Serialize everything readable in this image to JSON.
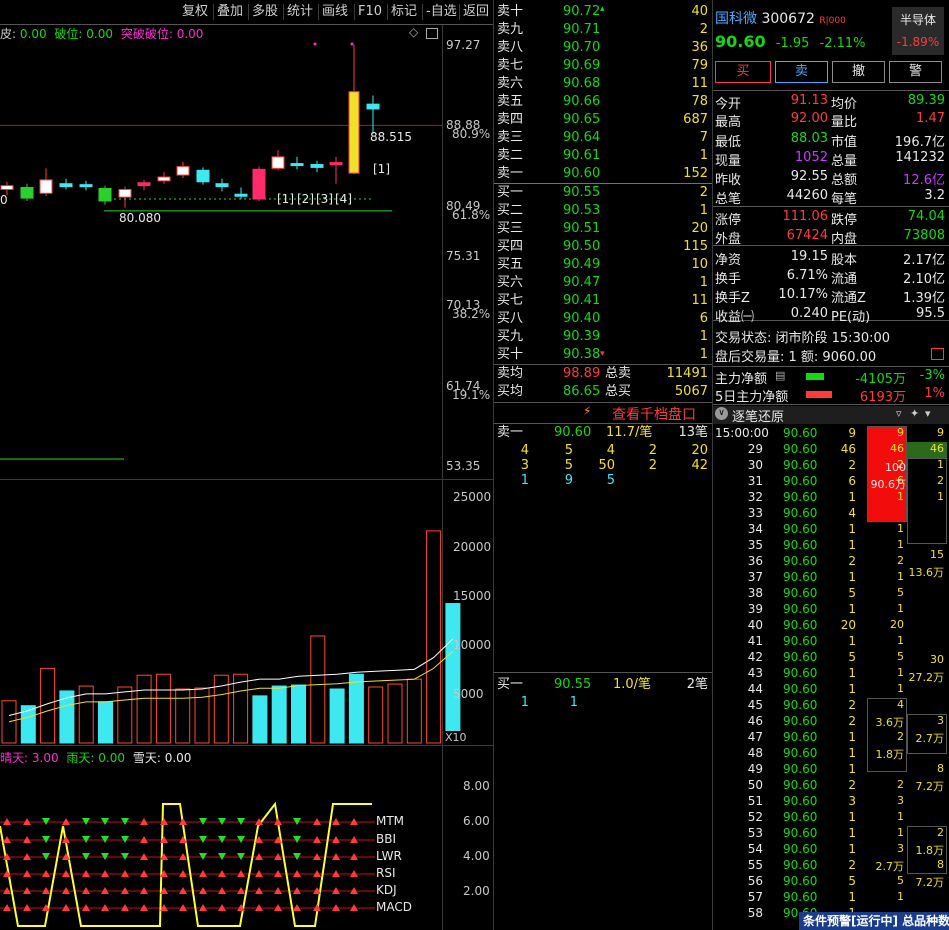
{
  "toolbar": {
    "items": [
      "复权",
      "叠加",
      "多股",
      "统计",
      "画线",
      "F10",
      "标记",
      "-自选",
      "返回"
    ]
  },
  "indicator_top": {
    "a_label": "皮:",
    "a_value": "0.00",
    "b_label": "破位:",
    "b_value": "0.00",
    "c_label": "突破破位:",
    "c_value": "0.00"
  },
  "price_axis": {
    "ticks": [
      "97.27",
      "88.88",
      "80.49",
      "75.31",
      "70.13",
      "61.74",
      "53.35"
    ],
    "pcts": [
      "80.9%",
      "61.8%",
      "38.2%",
      "19.1%"
    ],
    "hi_label": "88.515",
    "lo_label": "80.080",
    "left_label": "0",
    "marks": [
      "[1]",
      "[1]",
      "[2]",
      "[3]",
      "[4]"
    ]
  },
  "vol_axis": {
    "ticks": [
      "25000",
      "20000",
      "15000",
      "10000",
      "5000"
    ],
    "unit": "X10"
  },
  "bottom_ind": {
    "a_label": "晴天:",
    "a_value": "3.00",
    "b_label": "雨天:",
    "b_value": "0.00",
    "c_label": "雪天:",
    "c_value": "0.00",
    "ticks": [
      "8.00",
      "6.00",
      "4.00",
      "2.00"
    ],
    "signals": [
      "MTM",
      "BBI",
      "LWR",
      "RSI",
      "KDJ",
      "MACD"
    ]
  },
  "chart_data": {
    "type": "bar",
    "title": "",
    "series": [
      {
        "name": "成交量",
        "values": [
          4300,
          3800,
          7600,
          5300,
          5800,
          4200,
          5700,
          6900,
          7000,
          5500,
          5600,
          6900,
          7000,
          4800,
          5800,
          5900,
          10900,
          5500,
          7000,
          5700,
          6000,
          6500,
          21600,
          14200
        ]
      },
      {
        "name": "MA",
        "values": [
          2800,
          3300,
          4000,
          4600,
          5000,
          5000,
          5200,
          5400,
          5400,
          5400,
          5500,
          5800,
          6200,
          6500,
          6500,
          6800,
          6900,
          7000,
          7200,
          7300,
          7400,
          7500,
          8700,
          10600
        ]
      }
    ],
    "ylim": [
      0,
      27000
    ]
  },
  "orderbook": {
    "asks": [
      {
        "label": "卖十",
        "price": "90.72",
        "vol": "40"
      },
      {
        "label": "卖九",
        "price": "90.71",
        "vol": "2"
      },
      {
        "label": "卖八",
        "price": "90.70",
        "vol": "36"
      },
      {
        "label": "卖七",
        "price": "90.69",
        "vol": "79"
      },
      {
        "label": "卖六",
        "price": "90.68",
        "vol": "11"
      },
      {
        "label": "卖五",
        "price": "90.66",
        "vol": "78"
      },
      {
        "label": "卖四",
        "price": "90.65",
        "vol": "687"
      },
      {
        "label": "卖三",
        "price": "90.64",
        "vol": "7"
      },
      {
        "label": "卖二",
        "price": "90.61",
        "vol": "1"
      },
      {
        "label": "卖一",
        "price": "90.60",
        "vol": "152"
      }
    ],
    "bids": [
      {
        "label": "买一",
        "price": "90.55",
        "vol": "2"
      },
      {
        "label": "买二",
        "price": "90.53",
        "vol": "1"
      },
      {
        "label": "买三",
        "price": "90.51",
        "vol": "20"
      },
      {
        "label": "买四",
        "price": "90.50",
        "vol": "115"
      },
      {
        "label": "买五",
        "price": "90.49",
        "vol": "10"
      },
      {
        "label": "买六",
        "price": "90.47",
        "vol": "1"
      },
      {
        "label": "买七",
        "price": "90.41",
        "vol": "11"
      },
      {
        "label": "买八",
        "price": "90.40",
        "vol": "6"
      },
      {
        "label": "买九",
        "price": "90.39",
        "vol": "1"
      },
      {
        "label": "买十",
        "price": "90.38",
        "vol": "1"
      }
    ],
    "avg_ask_label": "卖均",
    "avg_ask": "98.89",
    "total_ask_label": "总卖",
    "total_ask": "11491",
    "avg_bid_label": "买均",
    "avg_bid": "86.65",
    "total_bid_label": "总买",
    "total_bid": "5067",
    "link": "查看千档盘口",
    "ask1_label": "卖一",
    "ask1_price": "90.60",
    "ask1_each": "11.7/笔",
    "ask1_count": "13笔",
    "ask_queue": [
      [
        "4",
        "5",
        "4",
        "2",
        "20"
      ],
      [
        "3",
        "5",
        "50",
        "2",
        "42"
      ],
      [
        "1",
        "9",
        "5",
        "",
        ""
      ]
    ],
    "bid1_label": "买一",
    "bid1_price": "90.55",
    "bid1_each": "1.0/笔",
    "bid1_count": "2笔",
    "bid_queue": [
      "1",
      "1"
    ]
  },
  "stock": {
    "name": "国科微",
    "code": "300672",
    "tag": "R|000",
    "price": "90.60",
    "chg": "-1.95",
    "pct": "-2.11%",
    "sector": "半导体",
    "sector_pct": "-1.89%"
  },
  "actions": [
    "买",
    "卖",
    "撤",
    "警"
  ],
  "stats": [
    [
      {
        "l": "今开",
        "v": "91.13",
        "c": "red"
      },
      {
        "l": "均价",
        "v": "89.39",
        "c": "grn"
      }
    ],
    [
      {
        "l": "最高",
        "v": "92.00",
        "c": "red"
      },
      {
        "l": "量比",
        "v": "1.47",
        "c": "red"
      }
    ],
    [
      {
        "l": "最低",
        "v": "88.03",
        "c": "grn"
      },
      {
        "l": "市值",
        "v": "196.7亿",
        "c": "wht"
      }
    ],
    [
      {
        "l": "现量",
        "v": "1052",
        "c": "pur"
      },
      {
        "l": "总量",
        "v": "141232",
        "c": "wht"
      }
    ],
    [
      {
        "l": "昨收",
        "v": "92.55",
        "c": "wht"
      },
      {
        "l": "总额",
        "v": "12.6亿",
        "c": "pur"
      }
    ],
    [
      {
        "l": "总笔",
        "v": "44260",
        "c": "wht"
      },
      {
        "l": "每笔",
        "v": "3.2",
        "c": "wht"
      }
    ],
    [
      {
        "l": "涨停",
        "v": "111.06",
        "c": "red"
      },
      {
        "l": "跌停",
        "v": "74.04",
        "c": "grn"
      }
    ],
    [
      {
        "l": "外盘",
        "v": "67424",
        "c": "red"
      },
      {
        "l": "内盘",
        "v": "73808",
        "c": "grn"
      }
    ],
    [
      {
        "l": "净资",
        "v": "19.15",
        "c": "wht"
      },
      {
        "l": "股本",
        "v": "2.17亿",
        "c": "wht"
      }
    ],
    [
      {
        "l": "换手",
        "v": "6.71%",
        "c": "wht"
      },
      {
        "l": "流通",
        "v": "2.10亿",
        "c": "wht"
      }
    ],
    [
      {
        "l": "换手Z",
        "v": "10.17%",
        "c": "wht"
      },
      {
        "l": "流通Z",
        "v": "1.39亿",
        "c": "wht"
      }
    ],
    [
      {
        "l": "收益㈠",
        "v": "0.240",
        "c": "wht"
      },
      {
        "l": "PE(动)",
        "v": "95.5",
        "c": "wht"
      }
    ]
  ],
  "status": {
    "text": "交易状态: 闭市阶段 15:30:00",
    "after": "盘后交易量: 1  额: 9060.00"
  },
  "flow": [
    {
      "label": "主力净额",
      "value": "-4105万",
      "pct": "-3%"
    },
    {
      "label": "5日主力净额",
      "value": "6193万",
      "pct": "1%"
    }
  ],
  "ticks_title": "逐笔还原",
  "ticks": [
    [
      "15:00:00",
      "90.60",
      "9"
    ],
    [
      "29",
      "90.60",
      "46"
    ],
    [
      "30",
      "90.60",
      "2"
    ],
    [
      "31",
      "90.60",
      "6"
    ],
    [
      "32",
      "90.60",
      "1"
    ],
    [
      "33",
      "90.60",
      "4"
    ],
    [
      "34",
      "90.60",
      "1"
    ],
    [
      "35",
      "90.60",
      "1"
    ],
    [
      "36",
      "90.60",
      "2"
    ],
    [
      "37",
      "90.60",
      "1"
    ],
    [
      "38",
      "90.60",
      "5"
    ],
    [
      "39",
      "90.60",
      "1"
    ],
    [
      "40",
      "90.60",
      "20"
    ],
    [
      "41",
      "90.60",
      "1"
    ],
    [
      "42",
      "90.60",
      "5"
    ],
    [
      "43",
      "90.60",
      "1"
    ],
    [
      "44",
      "90.60",
      "1"
    ],
    [
      "45",
      "90.60",
      "2"
    ],
    [
      "46",
      "90.60",
      "2"
    ],
    [
      "47",
      "90.60",
      "1"
    ],
    [
      "48",
      "90.60",
      "1"
    ],
    [
      "49",
      "90.60",
      "1"
    ],
    [
      "50",
      "90.60",
      "2"
    ],
    [
      "51",
      "90.60",
      "3"
    ],
    [
      "52",
      "90.60",
      "1"
    ],
    [
      "53",
      "90.60",
      "1"
    ],
    [
      "54",
      "90.60",
      "1"
    ],
    [
      "55",
      "90.60",
      "2"
    ],
    [
      "56",
      "90.60",
      "5"
    ],
    [
      "57",
      "90.60",
      "1"
    ],
    [
      "58",
      "90.60",
      "1"
    ]
  ],
  "tick_col2": [
    "9",
    "46",
    "2",
    "6",
    "1",
    "",
    "1",
    "1",
    "2",
    "1",
    "5",
    "1",
    "20",
    "1",
    "5",
    "1",
    "1",
    "4",
    "3.6万",
    "2",
    "1.8万",
    "",
    "2",
    "3",
    "1",
    "1",
    "3",
    "2.7万",
    "5",
    "1",
    ""
  ],
  "tick_col3": [
    "9",
    "46",
    "1",
    "2",
    "1",
    "",
    "",
    "",
    "",
    "",
    "",
    "",
    "",
    "",
    "",
    "",
    "",
    "",
    "3",
    "2.7万",
    "",
    "8",
    "7.2万",
    "",
    "",
    "2",
    "1.8万",
    "8",
    "7.2万",
    "",
    ""
  ],
  "tick_red": {
    "a": "100",
    "b": "90.6万"
  },
  "tick_side": [
    {
      "v": "15",
      "w": "13.6万"
    },
    {
      "v": "30",
      "w": "27.2万"
    }
  ],
  "footer": {
    "text": "条件预警[运行中] 总品种数"
  }
}
